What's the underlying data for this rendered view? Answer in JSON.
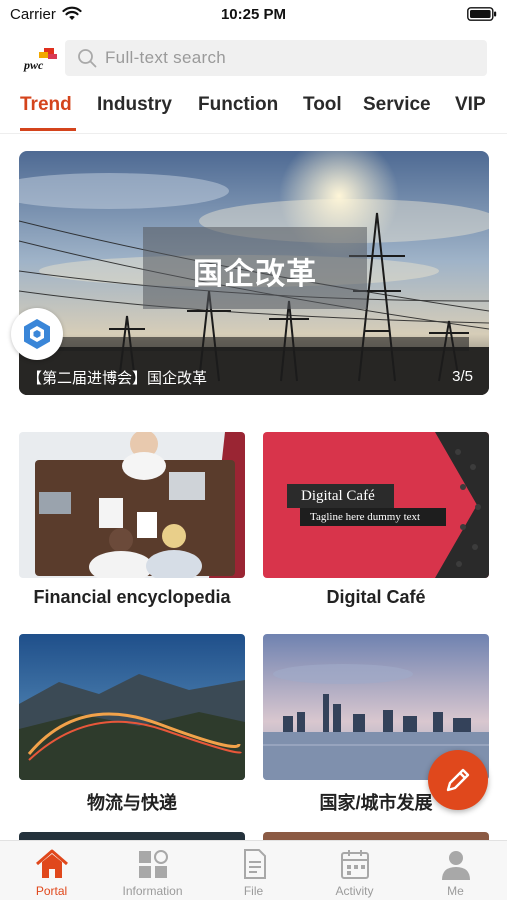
{
  "status_bar": {
    "carrier": "Carrier",
    "time": "10:25 PM"
  },
  "header": {
    "logo_text": "pwc",
    "search_placeholder": "Full-text search"
  },
  "tabs": [
    {
      "label": "Trend",
      "active": true
    },
    {
      "label": "Industry"
    },
    {
      "label": "Function"
    },
    {
      "label": "Tool"
    },
    {
      "label": "Service"
    },
    {
      "label": "VIP"
    }
  ],
  "banner": {
    "title": "国企改革",
    "caption": "【第二届进博会】国企改革",
    "counter": "3/5"
  },
  "cards": [
    {
      "title": "Financial encyclopedia"
    },
    {
      "title": "Digital Café",
      "image_title": "Digital Café",
      "image_tagline": "Tagline here dummy text"
    },
    {
      "title": "物流与快递"
    },
    {
      "title": "国家/城市发展"
    }
  ],
  "bottom_nav": [
    {
      "label": "Portal",
      "icon": "home-icon",
      "active": true
    },
    {
      "label": "Information",
      "icon": "grid-icon"
    },
    {
      "label": "File",
      "icon": "file-icon"
    },
    {
      "label": "Activity",
      "icon": "calendar-icon"
    },
    {
      "label": "Me",
      "icon": "person-icon"
    }
  ],
  "colors": {
    "accent": "#d4441c",
    "fab": "#e0481c",
    "digital_cafe": "#d8344b"
  }
}
